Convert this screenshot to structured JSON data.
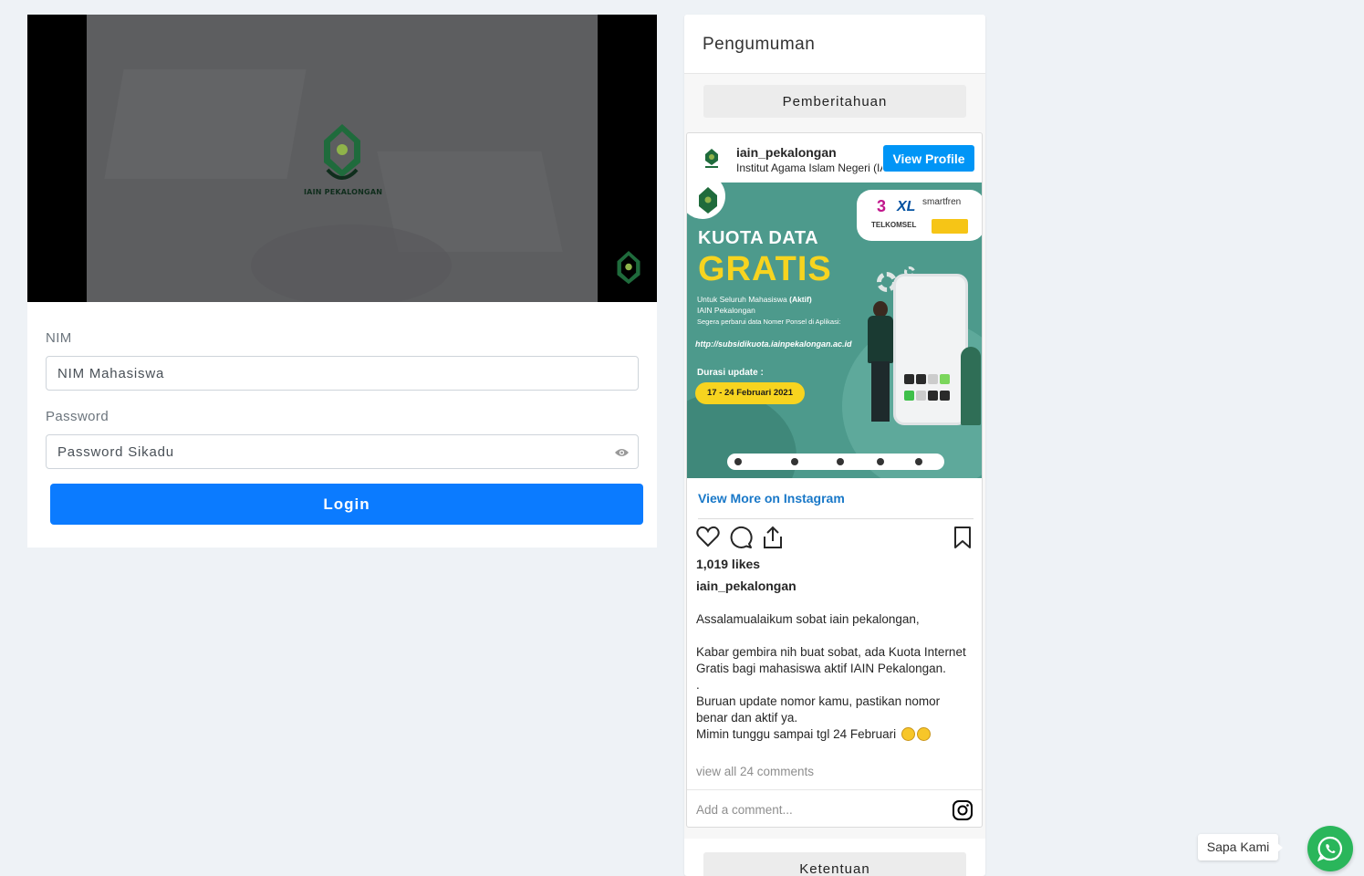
{
  "video": {
    "logo_text": "IAIN PEKALONGAN",
    "frame_color": "#5d5e60",
    "brand_green": "#1f6b3c"
  },
  "login": {
    "nim_label": "NIM",
    "nim_placeholder": "NIM Mahasiswa",
    "password_label": "Password",
    "password_placeholder": "Password Sikadu",
    "toggle_icon": "eye-icon",
    "login_button": "Login",
    "button_color": "#0b7bff"
  },
  "announcements": {
    "title": "Pengumuman",
    "tab_notice": "Pemberitahuan",
    "tab_terms": "Ketentuan",
    "instagram": {
      "username": "iain_pekalongan",
      "full_name": "Institut Agama Islam Negeri (IAIN) Pekalongan",
      "view_profile": "View Profile",
      "post": {
        "headline": "KUOTA DATA",
        "headline_big": "GRATIS",
        "text_line1_prefix": "Untuk Seluruh Mahasiswa ",
        "text_line1_bold": "(Aktif)",
        "text_line2": "IAIN Pekalongan",
        "text_line3": "Segera perbarui data Nomer Ponsel di Aplikasi:",
        "url": "http://subsidikuota.iainpekalongan.ac.id",
        "duration_label": "Durasi update :",
        "duration_value": "17 - 24 Februari 2021",
        "carriers": [
          "3",
          "XL",
          "smartfren",
          "TELKOMSEL"
        ],
        "bg_color": "#4d9a8c",
        "accent_color": "#f7d41f"
      },
      "view_more": "View More on Instagram",
      "likes": "1,019 likes",
      "caption_user": "iain_pekalongan",
      "caption_lines": [
        "Assalamualaikum sobat iain pekalongan,",
        "",
        "Kabar gembira nih buat sobat, ada Kuota Internet Gratis bagi mahasiswa aktif IAIN Pekalongan.",
        ".",
        "Buruan update nomor kamu, pastikan nomor benar dan aktif ya.",
        "Mimin tunggu sampai tgl 24 Februari"
      ],
      "view_comments": "view all 24 comments",
      "add_comment": "Add a comment..."
    }
  },
  "whatsapp": {
    "label": "Sapa Kami",
    "color": "#2ab65b"
  }
}
